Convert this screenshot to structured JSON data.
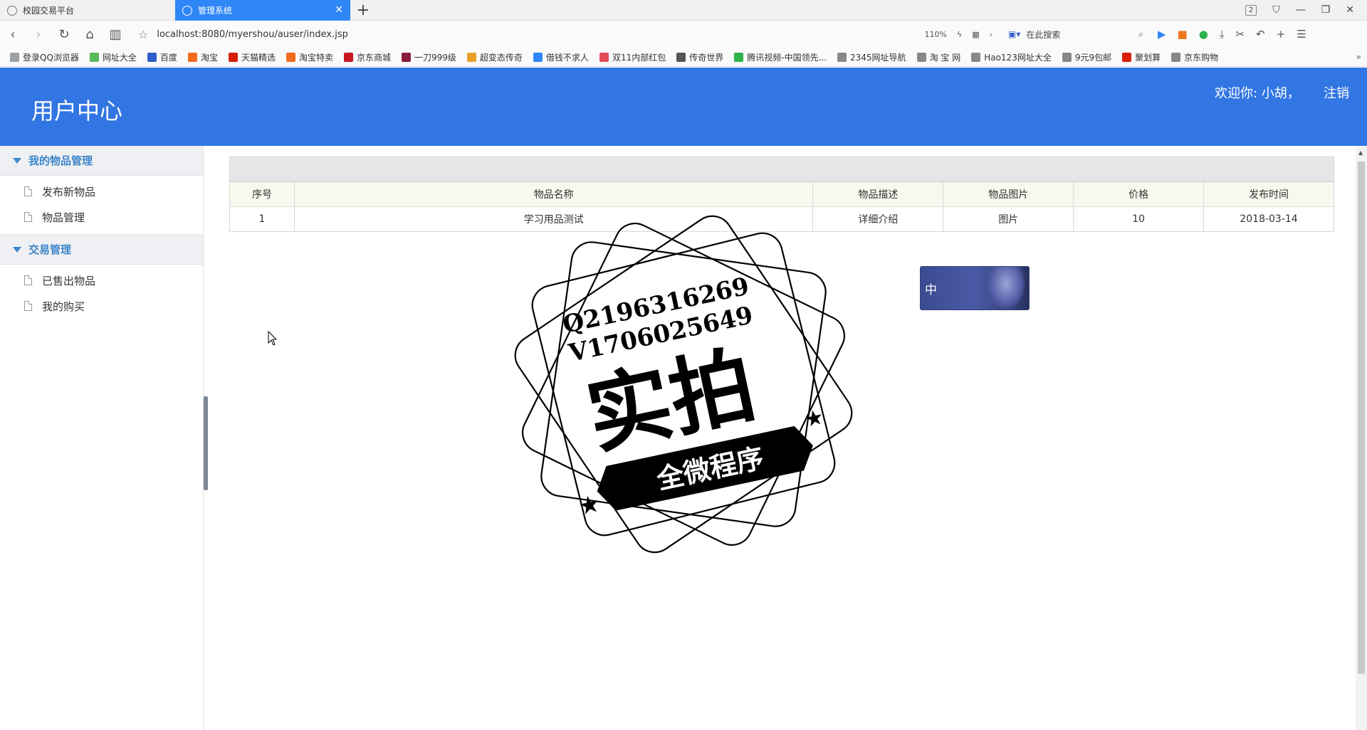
{
  "browser": {
    "tabs": [
      {
        "label": "校园交易平台",
        "active": false
      },
      {
        "label": "管理系统",
        "active": true
      }
    ],
    "tab_count": "2",
    "url": "localhost:8080/myershou/auser/index.jsp",
    "zoom": "110%",
    "search_placeholder": "在此搜索",
    "bookmarks": [
      {
        "label": "登录QQ浏览器",
        "color": "#9aa0a6"
      },
      {
        "label": "网址大全",
        "color": "#5cb85c"
      },
      {
        "label": "百度",
        "color": "#2f5ec9"
      },
      {
        "label": "淘宝",
        "color": "#f26a1d"
      },
      {
        "label": "天猫精选",
        "color": "#d81e06"
      },
      {
        "label": "淘宝特卖",
        "color": "#f26a1d"
      },
      {
        "label": "京东商城",
        "color": "#c81623"
      },
      {
        "label": "一刀999级",
        "color": "#8a1c3c"
      },
      {
        "label": "超变态传奇",
        "color": "#e6a12a"
      },
      {
        "label": "借钱不求人",
        "color": "#2f86f6"
      },
      {
        "label": "双11内部红包",
        "color": "#e34b55"
      },
      {
        "label": "传奇世界",
        "color": "#555555"
      },
      {
        "label": "腾讯视频-中国领先...",
        "color": "#30b34b"
      },
      {
        "label": "2345网址导航",
        "color": "#888888"
      },
      {
        "label": "淘 宝 网",
        "color": "#888888"
      },
      {
        "label": "Hao123网址大全",
        "color": "#888888"
      },
      {
        "label": "9元9包邮",
        "color": "#888888"
      },
      {
        "label": "聚划算",
        "color": "#d81e06"
      },
      {
        "label": "京东购物",
        "color": "#888888"
      }
    ]
  },
  "header": {
    "title": "用户中心",
    "welcome": "欢迎你: 小胡，",
    "logout": "注销",
    "bg_color": "#3276e3"
  },
  "sidebar": {
    "groups": [
      {
        "title": "我的物品管理",
        "items": [
          "发布新物品",
          "物品管理"
        ]
      },
      {
        "title": "交易管理",
        "items": [
          "已售出物品",
          "我的购买"
        ]
      }
    ]
  },
  "table": {
    "columns": [
      "序号",
      "物品名称",
      "物品描述",
      "物品图片",
      "价格",
      "发布时间"
    ],
    "rows": [
      [
        "1",
        "学习用品测试",
        "详细介绍",
        "图片",
        "10",
        "2018-03-14"
      ]
    ]
  },
  "ime": {
    "label": "中"
  },
  "watermark": {
    "line1": "Q2196316269",
    "line2": "V1706025649",
    "big": "实拍",
    "ribbon": "全微程序"
  }
}
